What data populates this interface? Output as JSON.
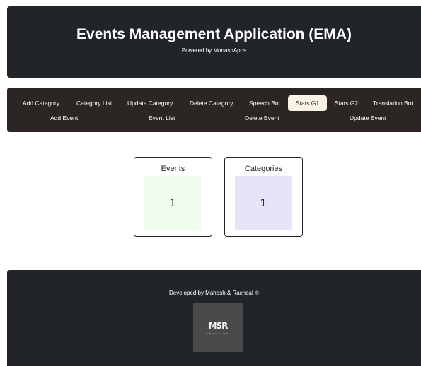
{
  "header": {
    "title": "Events Management Application (EMA)",
    "subtitle": "Powered by MonashApps"
  },
  "nav": {
    "row1": [
      "Add Category",
      "Category List",
      "Update Category",
      "Delete Category",
      "Speech Bot",
      "Stats G1",
      "Stats G2",
      "Translation Bot"
    ],
    "row2": [
      "Add Event",
      "Event List",
      "Delete Event",
      "Update Event"
    ],
    "active": "Stats G1"
  },
  "stats": {
    "events": {
      "label": "Events",
      "value": "1"
    },
    "categories": {
      "label": "Categories",
      "value": "1"
    }
  },
  "footer": {
    "credit": "Developed by Mahesh & Racheal",
    "registered_symbol": "®",
    "logo_text": "MSR",
    "logo_tagline": "PRODUCTION"
  },
  "colors": {
    "dark_panel": "#212529",
    "nav_bg": "#2b2623",
    "active_pill": "#faf3e4",
    "events_card": "#eefdee",
    "categories_card": "#e5e4f9"
  }
}
